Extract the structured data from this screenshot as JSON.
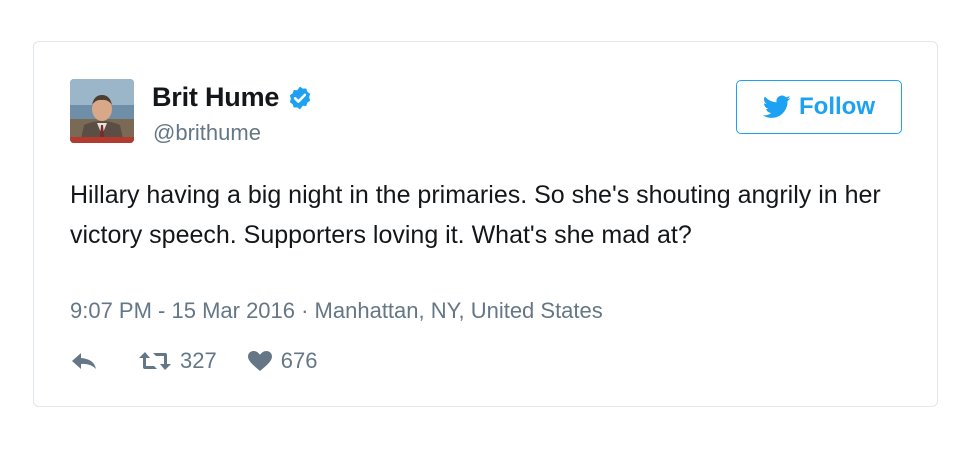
{
  "tweet": {
    "display_name": "Brit Hume",
    "handle": "@brithume",
    "follow_label": "Follow",
    "text": "Hillary having a big night in the primaries. So she's shouting angrily in her victory speech. Supporters loving it. What's she mad at?",
    "meta": "9:07 PM - 15 Mar 2016 · Manhattan, NY, United States",
    "retweet_count": "327",
    "like_count": "676"
  },
  "icons": {
    "verified": "verified-badge-icon",
    "follow": "twitter-bird-icon",
    "reply": "reply-icon",
    "retweet": "retweet-icon",
    "like": "heart-icon"
  },
  "colors": {
    "accent": "#1da1f2",
    "text": "#14171a",
    "secondary_text": "#657786",
    "border": "#e1e8ed"
  }
}
